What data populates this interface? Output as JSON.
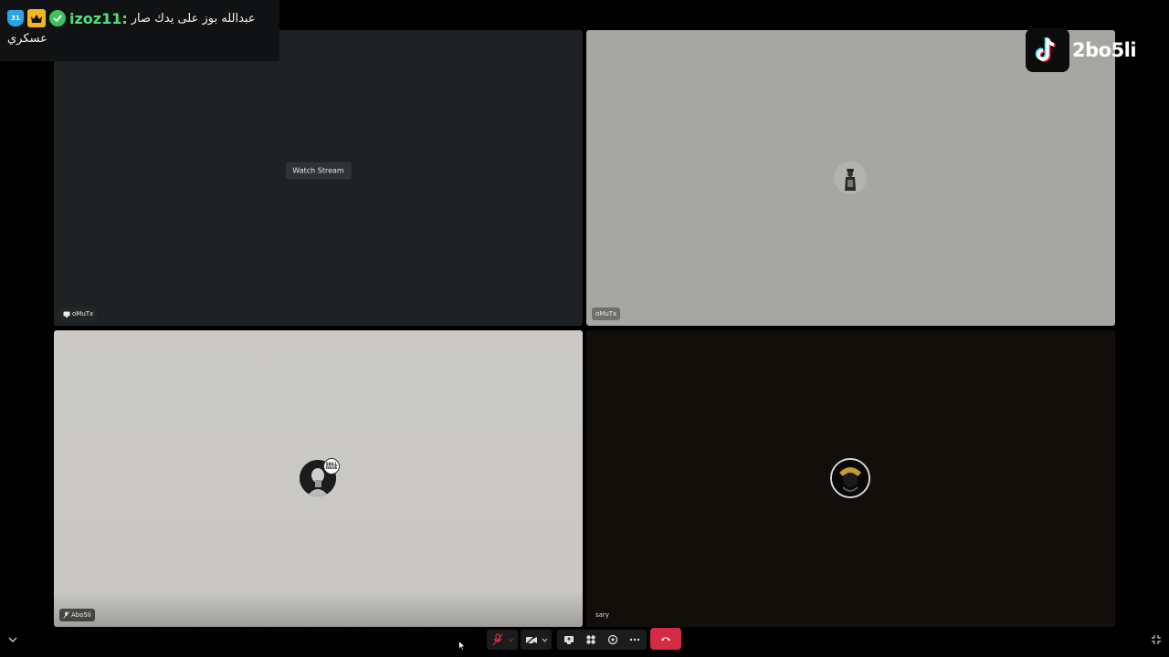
{
  "chat": {
    "badge_text": "31",
    "username": "izoz11:",
    "message": "عبدالله بوز على يدك صار",
    "message_cont": "عسكري"
  },
  "watermark": {
    "handle": "2bo5li"
  },
  "tiles": [
    {
      "name": "oMuTx",
      "button": "Watch Stream",
      "status": "streaming"
    },
    {
      "name": "oMuTx"
    },
    {
      "name": "Abo5li",
      "status": "muted",
      "avatar_badge": "SKILL ISSUE"
    },
    {
      "name": "sary"
    }
  ],
  "controls": {
    "mic": "mic-muted",
    "camera": "camera-off",
    "hangup_color": "#d42b45"
  }
}
